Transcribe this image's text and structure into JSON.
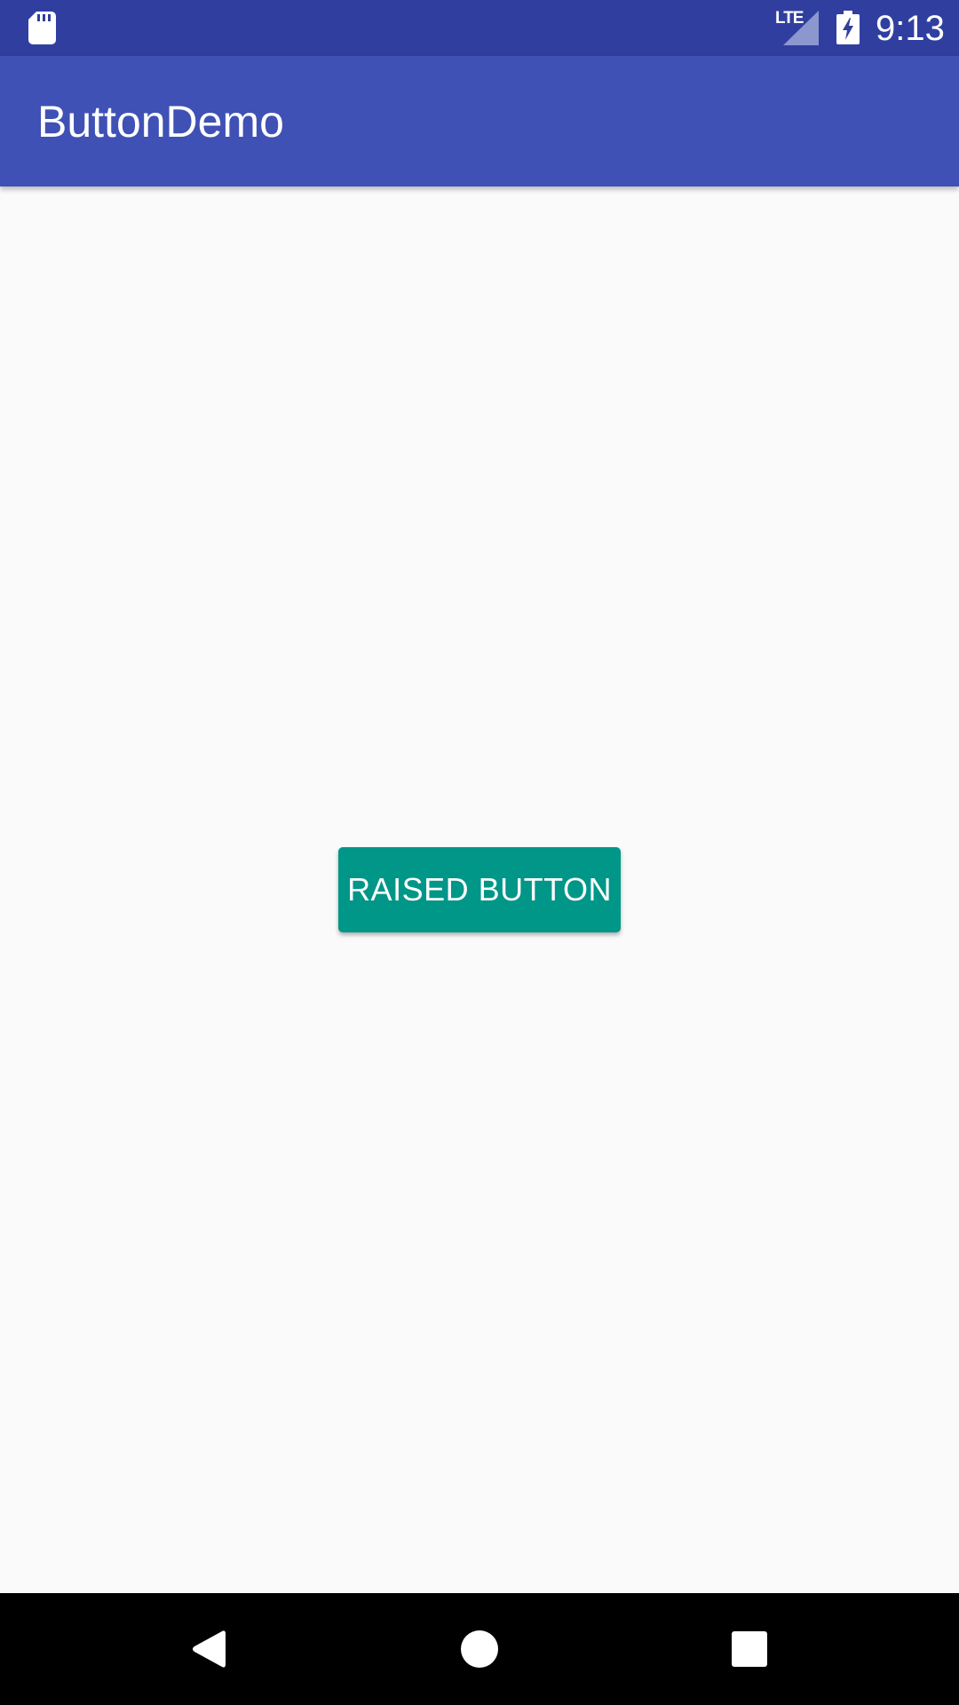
{
  "status_bar": {
    "sd_icon": "sd-card-icon",
    "network_label": "LTE",
    "signal_icon": "cell-signal-icon",
    "battery_icon": "battery-charging-icon",
    "time": "9:13"
  },
  "app_bar": {
    "title": "ButtonDemo"
  },
  "main": {
    "raised_button_label": "RAISED BUTTON"
  },
  "nav_bar": {
    "back_icon": "back-icon",
    "home_icon": "home-icon",
    "recents_icon": "recents-icon"
  },
  "colors": {
    "status_bar": "#303f9f",
    "app_bar": "#3f51b5",
    "button": "#009688",
    "background": "#fafafa",
    "nav_bar": "#000000"
  }
}
